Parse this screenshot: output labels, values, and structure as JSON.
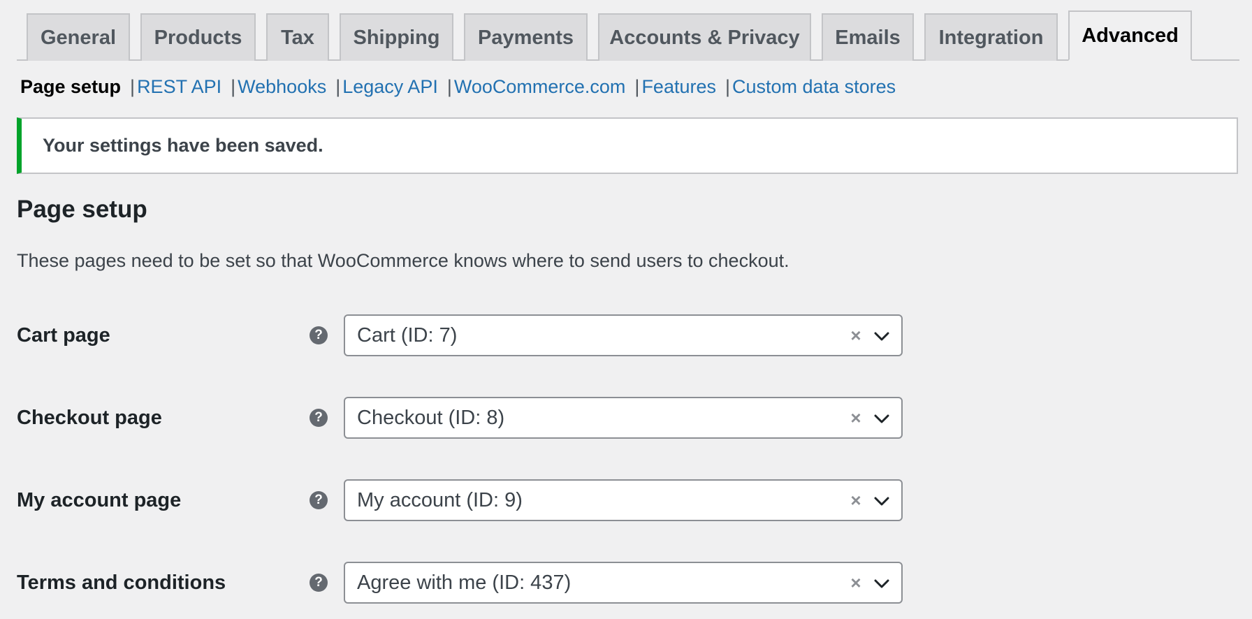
{
  "tabs": [
    {
      "label": "General",
      "width": 148,
      "active": false
    },
    {
      "label": "Products",
      "width": 165,
      "active": false
    },
    {
      "label": "Tax",
      "width": 90,
      "active": false
    },
    {
      "label": "Shipping",
      "width": 163,
      "active": false
    },
    {
      "label": "Payments",
      "width": 177,
      "active": false
    },
    {
      "label": "Accounts & Privacy",
      "width": 305,
      "active": false
    },
    {
      "label": "Emails",
      "width": 132,
      "active": false
    },
    {
      "label": "Integration",
      "width": 191,
      "active": false
    },
    {
      "label": "Advanced",
      "width": 177,
      "active": true
    }
  ],
  "subnav": {
    "current": "Page setup",
    "separator": "|",
    "links": [
      "REST API",
      "Webhooks",
      "Legacy API",
      "WooCommerce.com",
      "Features",
      "Custom data stores"
    ]
  },
  "notice": {
    "text": "Your settings have been saved.",
    "color": "#00a32a"
  },
  "section": {
    "title": "Page setup",
    "description": "These pages need to be set so that WooCommerce knows where to send users to checkout."
  },
  "fields": [
    {
      "label": "Cart page",
      "value": "Cart (ID: 7)",
      "help": "?",
      "clear": "×"
    },
    {
      "label": "Checkout page",
      "value": "Checkout (ID: 8)",
      "help": "?",
      "clear": "×"
    },
    {
      "label": "My account page",
      "value": "My account (ID: 9)",
      "help": "?",
      "clear": "×"
    },
    {
      "label": "Terms and conditions",
      "value": "Agree with me (ID: 437)",
      "help": "?",
      "clear": "×"
    }
  ],
  "colors": {
    "link": "#2271b1",
    "success": "#00a32a",
    "background": "#f0f0f1"
  }
}
